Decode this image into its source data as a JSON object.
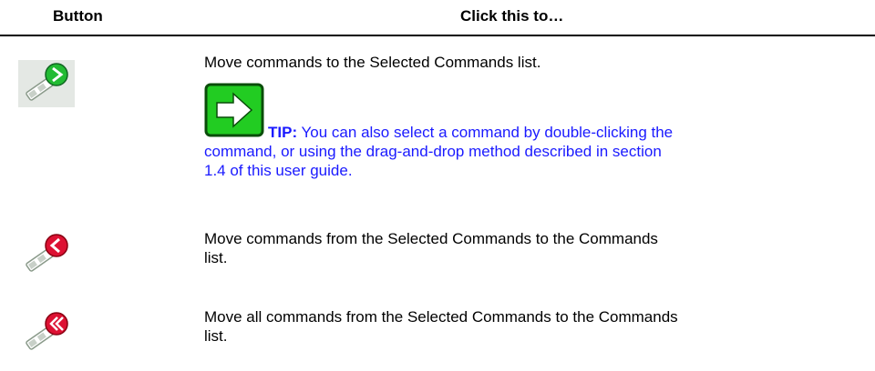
{
  "table": {
    "headers": {
      "button": "Button",
      "click": "Click this to…"
    },
    "rows": [
      {
        "icon": "select-right-arrow-icon",
        "accent": "#22bb33",
        "text": "Move commands to the Selected Commands list.",
        "tip": {
          "label": "TIP:",
          "text": " You can also select a command by double-clicking the command, or using the drag-and-drop method described in section 1.4 of this user guide."
        }
      },
      {
        "icon": "remove-left-arrow-icon",
        "accent": "#dd1133",
        "text": "Move commands from the Selected Commands to the Commands list."
      },
      {
        "icon": "remove-all-double-arrow-icon",
        "accent": "#dd1133",
        "text": "Move all commands from the Selected Commands to the Commands list."
      }
    ]
  },
  "colors": {
    "tip_text": "#1a1aff",
    "tip_icon_bg": "#22cc22"
  }
}
